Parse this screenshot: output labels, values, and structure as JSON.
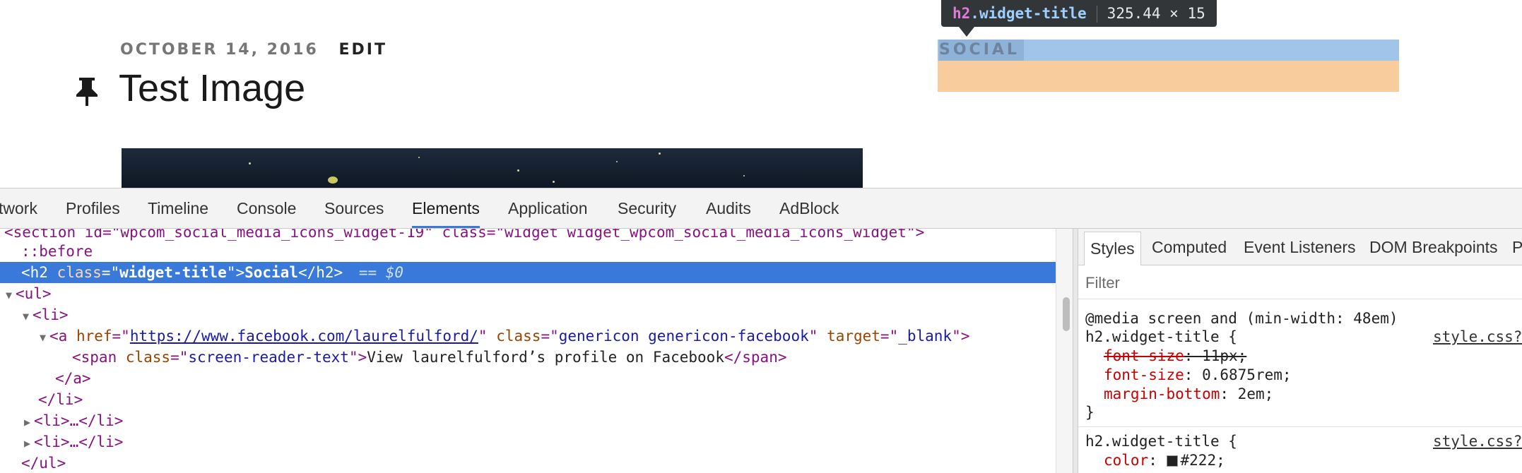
{
  "page": {
    "date": "OCTOBER 14, 2016",
    "edit_label": "EDIT",
    "post_title": "Test Image",
    "widget_title": "SOCIAL",
    "pin_icon": "pushpin-icon"
  },
  "inspector_tooltip": {
    "tag": "h2",
    "class": ".widget-title",
    "dimensions": "325.44 × 15"
  },
  "devtools": {
    "tabs": [
      "twork",
      "Profiles",
      "Timeline",
      "Console",
      "Sources",
      "Elements",
      "Application",
      "Security",
      "Audits",
      "AdBlock"
    ],
    "active_tab": "Elements",
    "dom": {
      "section_line": "<section id=\"wpcom_social_media_icons_widget-19\" class=\"widget widget_wpcom_social_media_icons_widget\">",
      "before": "::before",
      "h2_open": "<h2 ",
      "h2_attr": "class",
      "h2_eq": "=\"",
      "h2_val": "widget-title",
      "h2_close_q": "\">",
      "h2_text": "Social",
      "h2_end": "</h2>",
      "h2_marker": "== $0",
      "ul_open": "<ul>",
      "li_open": "<li>",
      "a_open": "<a ",
      "a_href_attr": "href",
      "a_href_val": "https://www.facebook.com/laurelfulford/",
      "a_class_attr": "class",
      "a_class_val": "genericon genericon-facebook",
      "a_target_attr": "target",
      "a_target_val": "_blank",
      "span_open": "<span ",
      "span_class_attr": "class",
      "span_class_val": "screen-reader-text",
      "span_text": "View laurelfulford’s profile on Facebook",
      "span_close": "</span>",
      "a_close": "</a>",
      "li_close": "</li>",
      "li_collapsed": "<li>…</li>",
      "ul_close": "</ul>"
    },
    "styles_panel": {
      "subtabs": [
        "Styles",
        "Computed",
        "Event Listeners",
        "DOM Breakpoints",
        "P"
      ],
      "active_subtab": "Styles",
      "filter_placeholder": "Filter",
      "rule1": {
        "media": "@media screen and (min-width: 48em)",
        "selector": "h2.widget-title {",
        "source": "style.css?",
        "decl1_prop": "font-size",
        "decl1_val": "11px;",
        "decl2_prop": "font-size",
        "decl2_val": "0.6875rem;",
        "decl3_prop": "margin-bottom",
        "decl3_val": "2em;",
        "close": "}"
      },
      "rule2": {
        "selector": "h2.widget-title {",
        "source": "style.css?",
        "decl1_prop": "color",
        "decl1_val": "#222;"
      }
    }
  }
}
